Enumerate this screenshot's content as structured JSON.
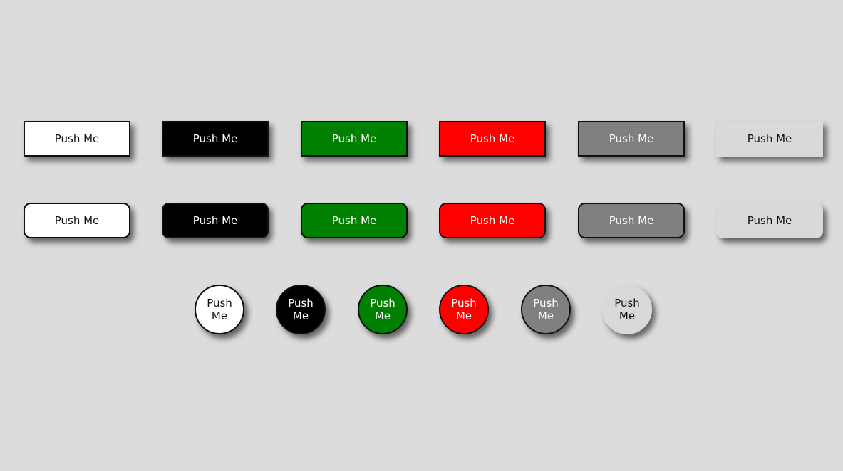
{
  "colors": {
    "background": "#dcdcdc",
    "white": "#ffffff",
    "black": "#000000",
    "green": "#008000",
    "red": "#ff0000",
    "gray": "#808080",
    "light_gray": "#d9d9d9"
  },
  "rows": {
    "square": {
      "buttons": [
        {
          "label": "Push Me"
        },
        {
          "label": "Push Me"
        },
        {
          "label": "Push Me"
        },
        {
          "label": "Push Me"
        },
        {
          "label": "Push Me"
        },
        {
          "label": "Push Me"
        }
      ]
    },
    "rounded": {
      "buttons": [
        {
          "label": "Push Me"
        },
        {
          "label": "Push Me"
        },
        {
          "label": "Push Me"
        },
        {
          "label": "Push Me"
        },
        {
          "label": "Push Me"
        },
        {
          "label": "Push Me"
        }
      ]
    },
    "circle": {
      "buttons": [
        {
          "label": "Push Me"
        },
        {
          "label": "Push Me"
        },
        {
          "label": "Push Me"
        },
        {
          "label": "Push Me"
        },
        {
          "label": "Push Me"
        },
        {
          "label": "Push Me"
        }
      ]
    }
  }
}
